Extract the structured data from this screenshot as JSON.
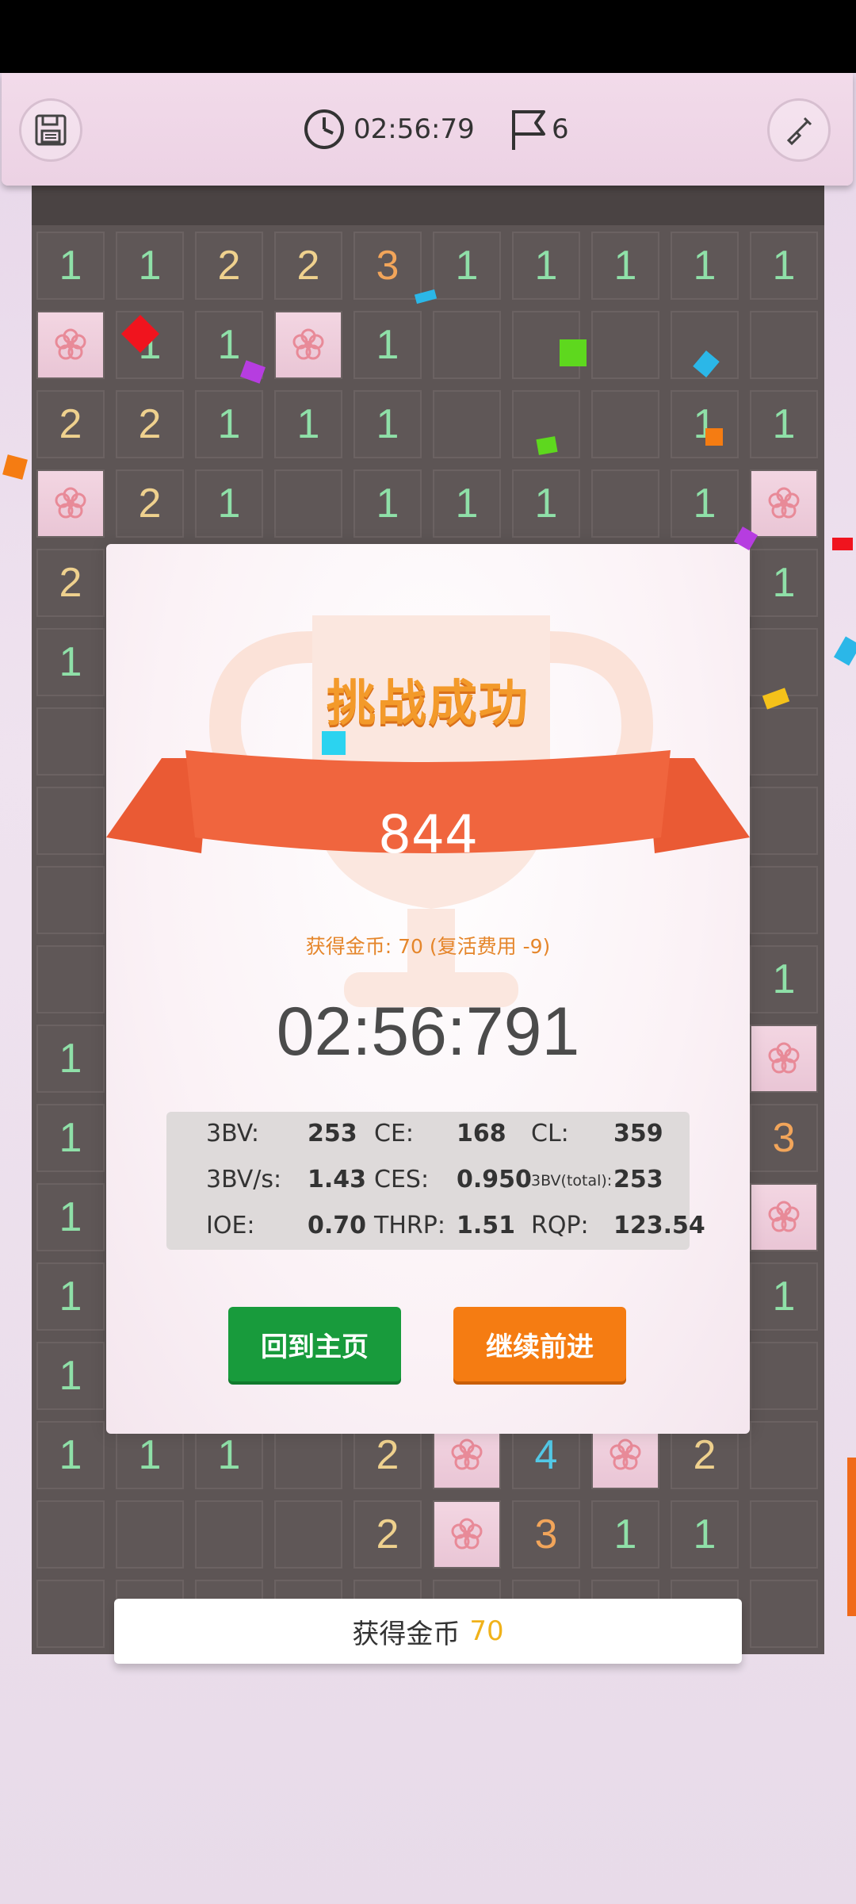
{
  "topbar": {
    "save_icon": "save-icon",
    "timer_icon": "clock-icon",
    "timer": "02:56:79",
    "flag_icon": "flag-icon",
    "flags": "6",
    "tool_icon": "shovel-icon"
  },
  "board_rows": [
    [
      "1",
      "1",
      "2",
      "2",
      "3",
      "1",
      "1",
      "1",
      "1",
      "1"
    ],
    [
      "F",
      "1",
      "1",
      "F",
      "1",
      "",
      "",
      "",
      "",
      ""
    ],
    [
      "2",
      "2",
      "1",
      "1",
      "1",
      "",
      "",
      "",
      "1",
      "1"
    ],
    [
      "F",
      "2",
      "1",
      "",
      "1",
      "1",
      "1",
      "",
      "1",
      "F"
    ],
    [
      "2",
      "",
      "",
      "",
      "",
      "",
      "",
      "",
      "",
      "1"
    ],
    [
      "1",
      "",
      "",
      "",
      "",
      "",
      "",
      "",
      "",
      ""
    ],
    [
      "",
      "",
      "",
      "",
      "",
      "",
      "",
      "",
      "",
      ""
    ],
    [
      "",
      "",
      "",
      "",
      "",
      "",
      "",
      "",
      "",
      ""
    ],
    [
      "",
      "",
      "",
      "",
      "",
      "",
      "",
      "",
      "",
      ""
    ],
    [
      "",
      "",
      "",
      "",
      "",
      "",
      "",
      "",
      "",
      "1"
    ],
    [
      "1",
      "",
      "",
      "",
      "",
      "",
      "",
      "",
      "",
      "F"
    ],
    [
      "1",
      "",
      "",
      "",
      "",
      "",
      "",
      "",
      "",
      "3"
    ],
    [
      "1",
      "",
      "",
      "",
      "",
      "",
      "",
      "",
      "",
      "F"
    ],
    [
      "1",
      "",
      "",
      "",
      "",
      "",
      "",
      "",
      "",
      "1"
    ],
    [
      "1",
      "",
      "",
      "",
      "",
      "",
      "",
      "",
      "",
      ""
    ],
    [
      "1",
      "1",
      "1",
      "",
      "2",
      "F",
      "4",
      "F",
      "2",
      ""
    ],
    [
      "",
      "",
      "",
      "",
      "2",
      "F",
      "3",
      "1",
      "1",
      ""
    ],
    [
      "",
      "",
      "",
      "",
      "",
      "",
      "",
      "",
      "",
      ""
    ]
  ],
  "dialog": {
    "title": "挑战成功",
    "score": "844",
    "coins_line": "获得金币: 70 (复活费用 -9)",
    "time": "02:56:791",
    "stats": {
      "bv_label": "3BV:",
      "bv": "253",
      "ce_label": "CE:",
      "ce": "168",
      "cl_label": "CL:",
      "cl": "359",
      "bvs_label": "3BV/s:",
      "bvs": "1.43",
      "ces_label": "CES:",
      "ces": "0.950",
      "bvtotal_label": "3BV(total):",
      "bvtotal": "253",
      "ioe_label": "IOE:",
      "ioe": "0.70",
      "thrp_label": "THRP:",
      "thrp": "1.51",
      "rqp_label": "RQP:",
      "rqp": "123.54"
    },
    "home_button": "回到主页",
    "continue_button": "继续前进"
  },
  "coin_bar": {
    "label": "获得金币",
    "value": "70"
  }
}
